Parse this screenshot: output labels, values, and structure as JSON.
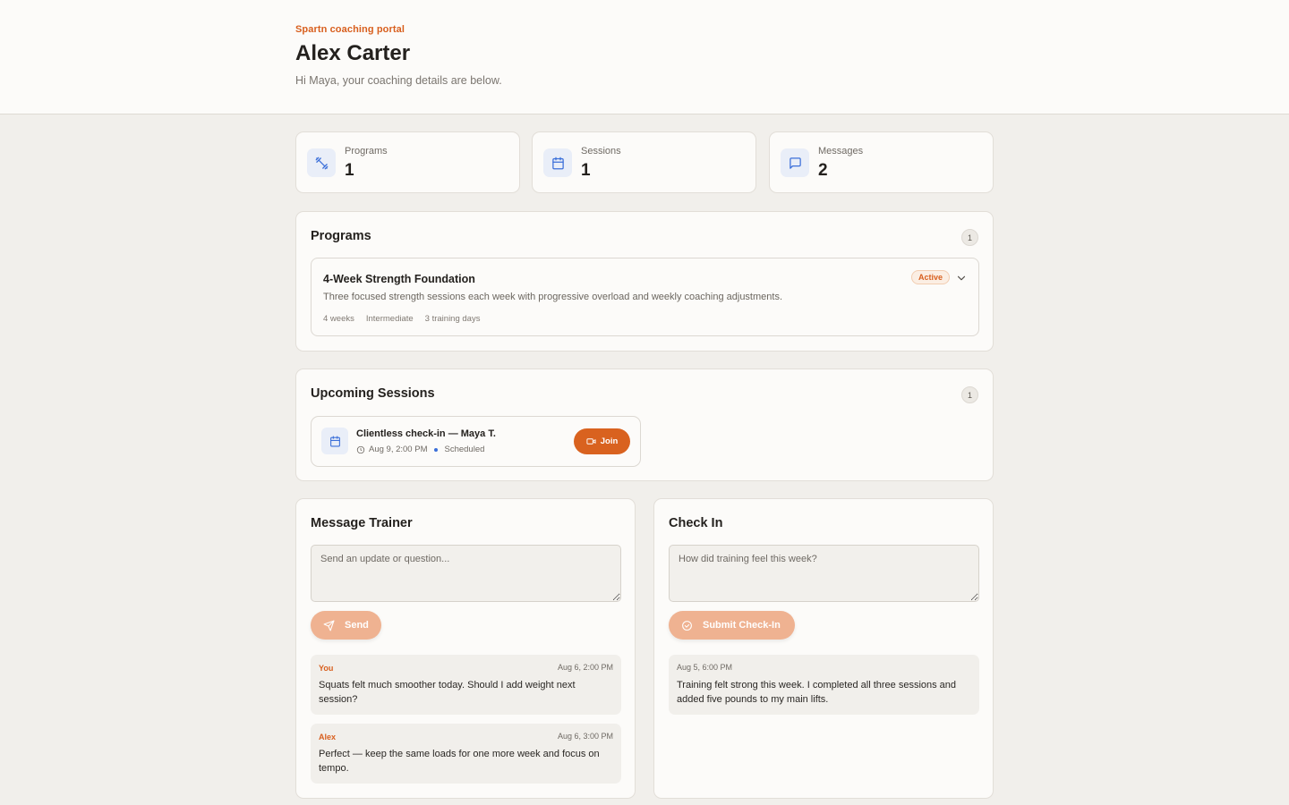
{
  "header": {
    "eyebrow": "Spartn coaching portal",
    "title": "Alex Carter",
    "subtitle": "Hi Maya, your coaching details are below."
  },
  "stats": [
    {
      "label": "Programs",
      "value": "1",
      "icon": "dumbbell-icon"
    },
    {
      "label": "Sessions",
      "value": "1",
      "icon": "calendar-icon"
    },
    {
      "label": "Messages",
      "value": "2",
      "icon": "message-icon"
    }
  ],
  "programs": {
    "title": "Programs",
    "count": "1",
    "items": [
      {
        "name": "4-Week Strength Foundation",
        "description": "Three focused strength sessions each week with progressive overload and weekly coaching adjustments.",
        "meta": [
          "4 weeks",
          "Intermediate",
          "3 training days"
        ],
        "status": "Active"
      }
    ]
  },
  "sessions": {
    "title": "Upcoming Sessions",
    "count": "1",
    "items": [
      {
        "title": "Clientless check-in — Maya T.",
        "time": "Aug 9, 2:00 PM",
        "status": "Scheduled",
        "join_label": "Join"
      }
    ]
  },
  "message_trainer": {
    "title": "Message Trainer",
    "placeholder": "Send an update or question...",
    "send_label": "Send",
    "messages": [
      {
        "author": "You",
        "time": "Aug 6, 2:00 PM",
        "text": "Squats felt much smoother today. Should I add weight next session?"
      },
      {
        "author": "Alex",
        "time": "Aug 6, 3:00 PM",
        "text": "Perfect — keep the same loads for one more week and focus on tempo."
      }
    ]
  },
  "check_in": {
    "title": "Check In",
    "placeholder": "How did training feel this week?",
    "submit_label": "Submit Check-In",
    "entries": [
      {
        "time": "Aug 5, 6:00 PM",
        "text": "Training felt strong this week. I completed all three sessions and added five pounds to my main lifts."
      }
    ]
  },
  "colors": {
    "accent": "#d9621f",
    "accent_light": "#efb291",
    "icon_blue": "#3b6fd9"
  }
}
